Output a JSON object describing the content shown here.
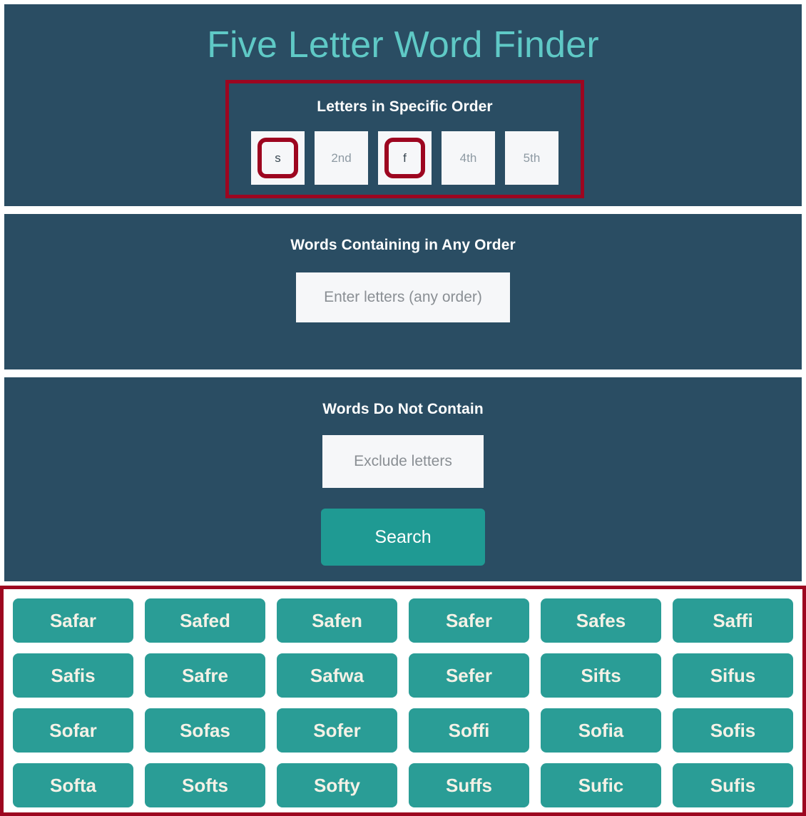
{
  "app": {
    "title": "Five Letter Word Finder",
    "title_color": "#5fc9c6",
    "panel_color": "#2a4d63",
    "accent_color": "#1f9a93",
    "chip_color": "#2a9d96",
    "annotation_color": "#9d0620"
  },
  "ordered_section": {
    "heading": "Letters in Specific Order",
    "boxes": [
      {
        "value": "s",
        "is_placeholder": false,
        "highlighted": true
      },
      {
        "value": "2nd",
        "is_placeholder": true,
        "highlighted": false
      },
      {
        "value": "f",
        "is_placeholder": false,
        "highlighted": true
      },
      {
        "value": "4th",
        "is_placeholder": true,
        "highlighted": false
      },
      {
        "value": "5th",
        "is_placeholder": true,
        "highlighted": false
      }
    ]
  },
  "any_order_section": {
    "heading": "Words Containing in Any Order",
    "input_value": "",
    "input_placeholder": "Enter letters (any order)"
  },
  "exclude_section": {
    "heading": "Words Do Not Contain",
    "input_value": "",
    "input_placeholder": "Exclude letters",
    "search_label": "Search"
  },
  "results": {
    "words": [
      "Safar",
      "Safed",
      "Safen",
      "Safer",
      "Safes",
      "Saffi",
      "Safis",
      "Safre",
      "Safwa",
      "Sefer",
      "Sifts",
      "Sifus",
      "Sofar",
      "Sofas",
      "Sofer",
      "Soffi",
      "Sofia",
      "Sofis",
      "Softa",
      "Softs",
      "Softy",
      "Suffs",
      "Sufic",
      "Sufis"
    ]
  }
}
